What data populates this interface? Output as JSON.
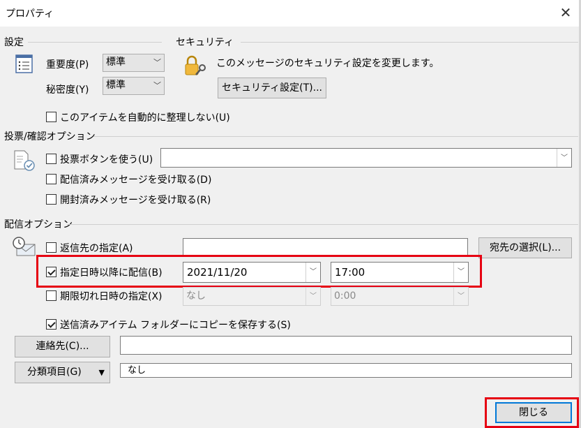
{
  "window": {
    "title": "プロパティ",
    "close_glyph": "✕"
  },
  "settings": {
    "section_label": "設定",
    "importance_label": "重要度(P)",
    "importance_value": "標準",
    "sensitivity_label": "秘密度(Y)",
    "sensitivity_value": "標準",
    "no_autoarchive_label": "このアイテムを自動的に整理しない(U)",
    "no_autoarchive_checked": false
  },
  "security": {
    "section_label": "セキュリティ",
    "description": "このメッセージのセキュリティ設定を変更します。",
    "button_label": "セキュリティ設定(T)..."
  },
  "voting": {
    "section_label": "投票/確認オプション",
    "use_voting_label": "投票ボタンを使う(U)",
    "use_voting_value": "",
    "delivery_receipt_label": "配信済みメッセージを受け取る(D)",
    "read_receipt_label": "開封済みメッセージを受け取る(R)"
  },
  "delivery": {
    "section_label": "配信オプション",
    "reply_to_label": "返信先の指定(A)",
    "reply_to_value": "",
    "select_names_label": "宛先の選択(L)...",
    "delay_label": "指定日時以降に配信(B)",
    "delay_checked": true,
    "delay_date": "2021/11/20",
    "delay_time": "17:00",
    "expires_label": "期限切れ日時の指定(X)",
    "expires_date": "なし",
    "expires_time": "0:00",
    "save_copy_label": "送信済みアイテム フォルダーにコピーを保存する(S)",
    "save_copy_checked": true
  },
  "contacts": {
    "button_label": "連絡先(C)...",
    "value": ""
  },
  "categories": {
    "button_label": "分類項目(G)",
    "value": "なし"
  },
  "footer": {
    "close_label": "閉じる"
  },
  "highlight_color": "#e60012"
}
